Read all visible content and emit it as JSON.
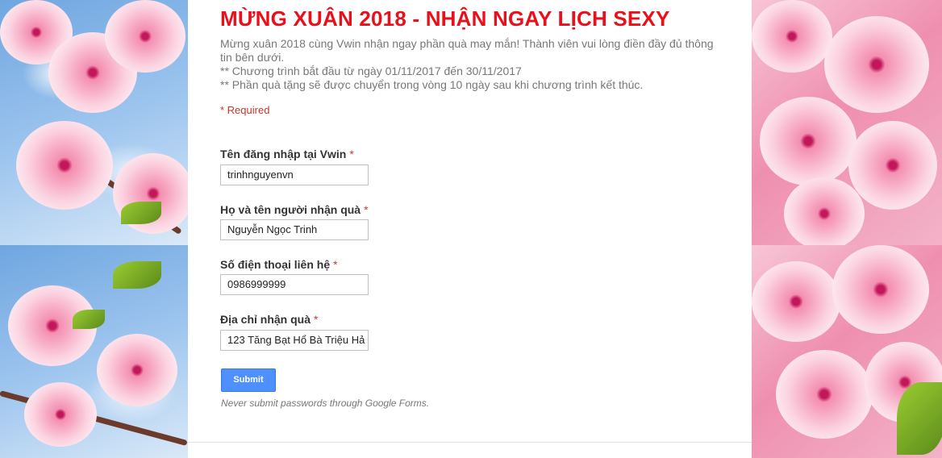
{
  "form": {
    "title": "MỪNG XUÂN 2018 - NHẬN NGAY LỊCH SEXY",
    "description": [
      "Mừng xuân 2018 cùng Vwin nhận ngay phần quà may mắn! Thành viên vui lòng điền đầy đủ thông tin bên dưới.",
      "** Chương trình bắt đầu từ ngày 01/11/2017 đến 30/11/2017",
      "** Phần quà tặng sẽ được chuyển trong vòng 10 ngày sau khi chương trình kết thúc."
    ],
    "required_note": "* Required",
    "fields": [
      {
        "label": "Tên đăng nhập tại Vwin",
        "required_mark": "*",
        "value": "trinhnguyenvn"
      },
      {
        "label": "Họ và tên người nhận quà",
        "required_mark": "*",
        "value": "Nguyễn Ngọc Trinh"
      },
      {
        "label": "Số điện thoại liên hệ",
        "required_mark": "*",
        "value": "0986999999"
      },
      {
        "label": "Địa chỉ nhận quà",
        "required_mark": "*",
        "value": "123 Tăng Bạt Hổ Bà Triệu Hả"
      }
    ],
    "submit_label": "Submit",
    "disclaimer": "Never submit passwords through Google Forms."
  },
  "colors": {
    "title": "#e8101a",
    "submit_button": "#4d90fe",
    "required": "#c43b31"
  },
  "background": {
    "theme": "cherry-blossom-photo"
  }
}
